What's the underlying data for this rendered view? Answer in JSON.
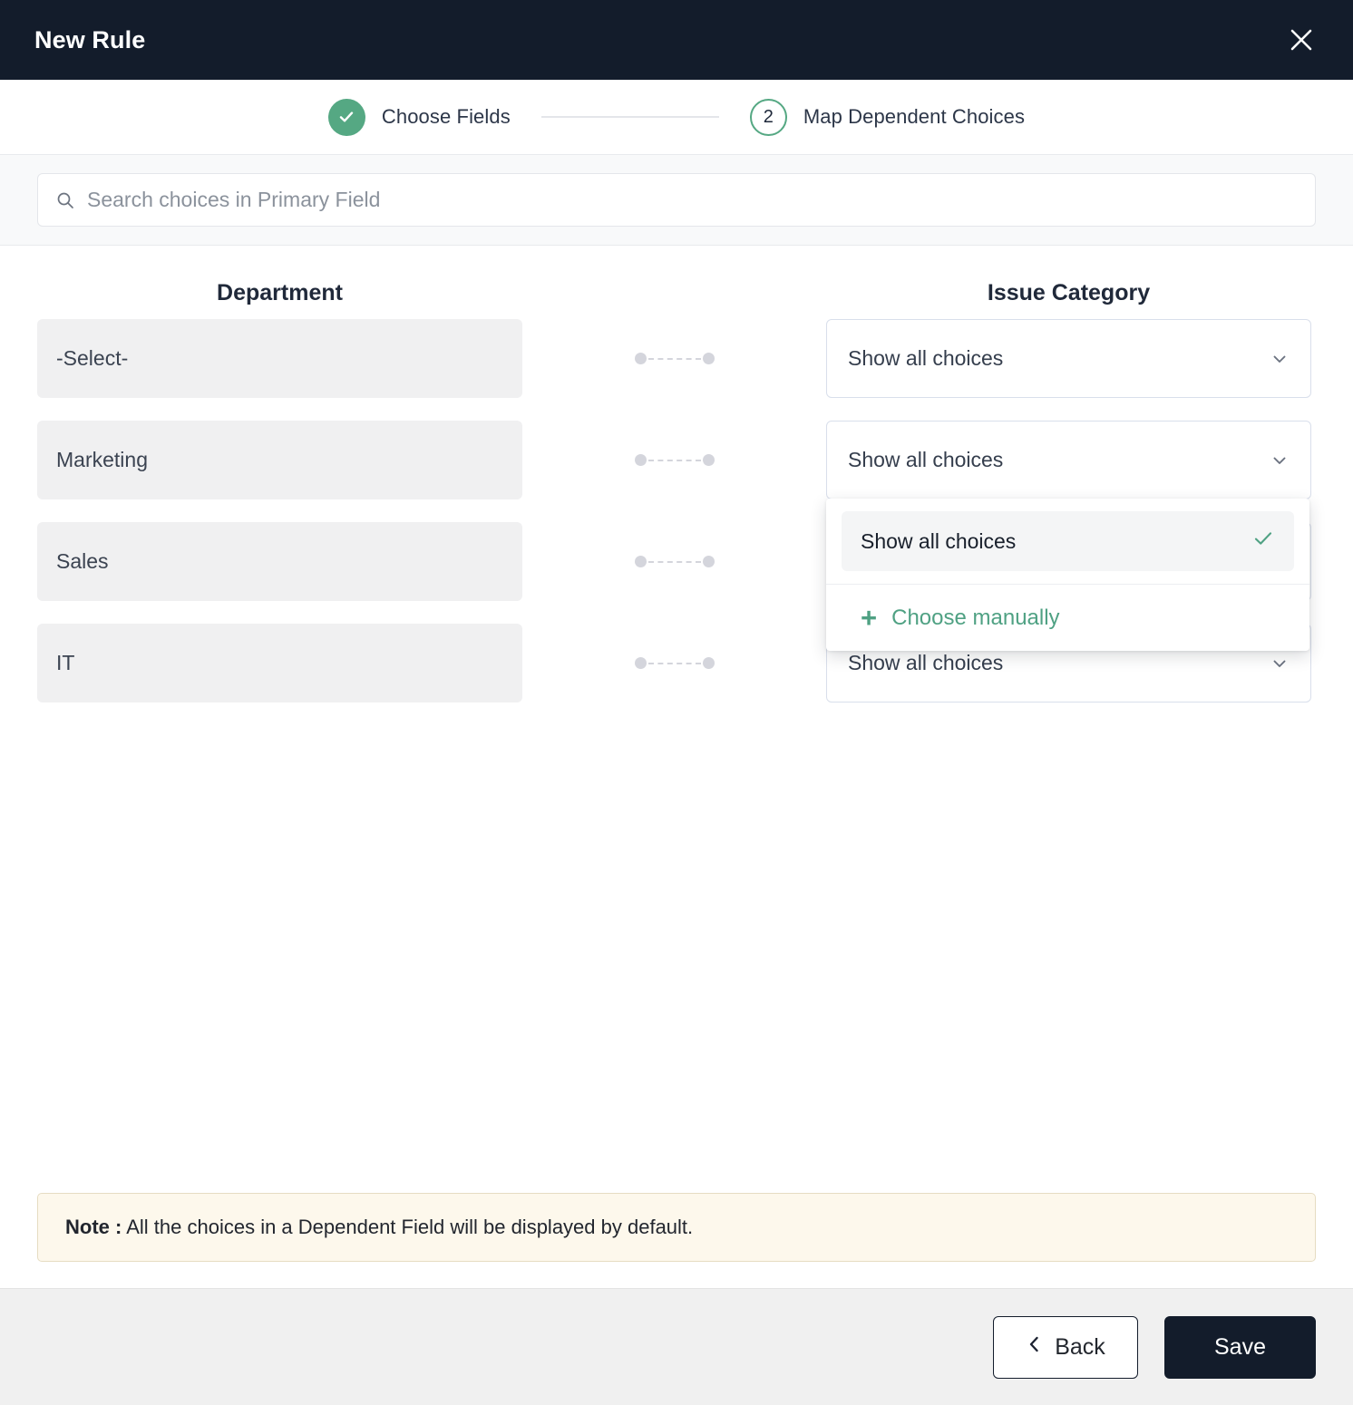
{
  "window": {
    "title": "New Rule",
    "close_icon": "close-icon"
  },
  "stepper": {
    "steps": [
      {
        "label": "Choose Fields",
        "state": "done",
        "indicator": "check-icon"
      },
      {
        "label": "Map Dependent Choices",
        "state": "current",
        "indicator": "2"
      }
    ]
  },
  "search": {
    "placeholder": "Search choices in Primary Field",
    "value": "",
    "icon": "search-icon"
  },
  "mapping": {
    "primary_column_header": "Department",
    "dependent_column_header": "Issue Category",
    "rows": [
      {
        "primary": "-Select-",
        "dependent": "Show all choices"
      },
      {
        "primary": "Marketing",
        "dependent": "Show all choices"
      },
      {
        "primary": "Sales",
        "dependent": "Show all choices"
      },
      {
        "primary": "IT",
        "dependent": "Show all choices"
      }
    ]
  },
  "dropdown": {
    "open_on_row_index": 1,
    "options": [
      {
        "label": "Show all choices",
        "selected": true
      }
    ],
    "action": {
      "label": "Choose manually",
      "icon": "plus-icon"
    }
  },
  "note": {
    "prefix": "Note :",
    "text": " All the choices in a Dependent Field will be displayed by default."
  },
  "footer": {
    "back_label": "Back",
    "back_icon": "chevron-left-icon",
    "save_label": "Save"
  },
  "colors": {
    "header_bg": "#131c2b",
    "accent_green": "#55a883",
    "note_bg": "#fdf8ec",
    "note_border": "#e6dcc2",
    "row_bg": "#f0f0f1",
    "footer_bg": "#f0f0f0"
  }
}
